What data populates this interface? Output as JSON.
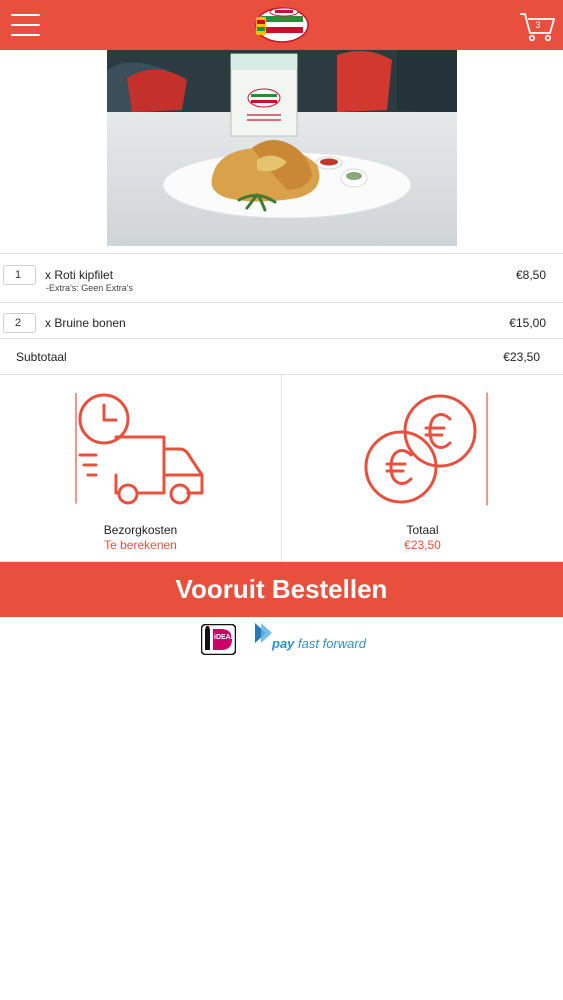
{
  "header": {
    "menu_icon": "hamburger-menu-icon",
    "logo_icon": "jennys-logo",
    "cart_icon": "shopping-cart-icon",
    "cart_count": "3",
    "brand_color": "#e8503d"
  },
  "order_items": [
    {
      "qty": "1",
      "name": "x Roti kipfilet",
      "extra": "-Extra's: Geen Extra's",
      "price": "€8,50"
    },
    {
      "qty": "2",
      "name": "x Bruine bonen",
      "extra": "",
      "price": "€15,00"
    }
  ],
  "subtotal": {
    "label": "Subtotaal",
    "value": "€23,50"
  },
  "delivery": {
    "icon": "delivery-truck-clock-icon",
    "label": "Bezorgkosten",
    "value": "Te berekenen"
  },
  "total": {
    "icon": "euro-coins-icon",
    "label": "Totaal",
    "value": "€23,50"
  },
  "order_button": {
    "label": "Vooruit Bestellen"
  },
  "payment": {
    "ideal_icon": "ideal-logo",
    "ideal_text": "iDEAL",
    "payfast_icon": "pay-fast-forward-logo",
    "payfast_bold": "pay",
    "payfast_rest": " fast forward"
  }
}
